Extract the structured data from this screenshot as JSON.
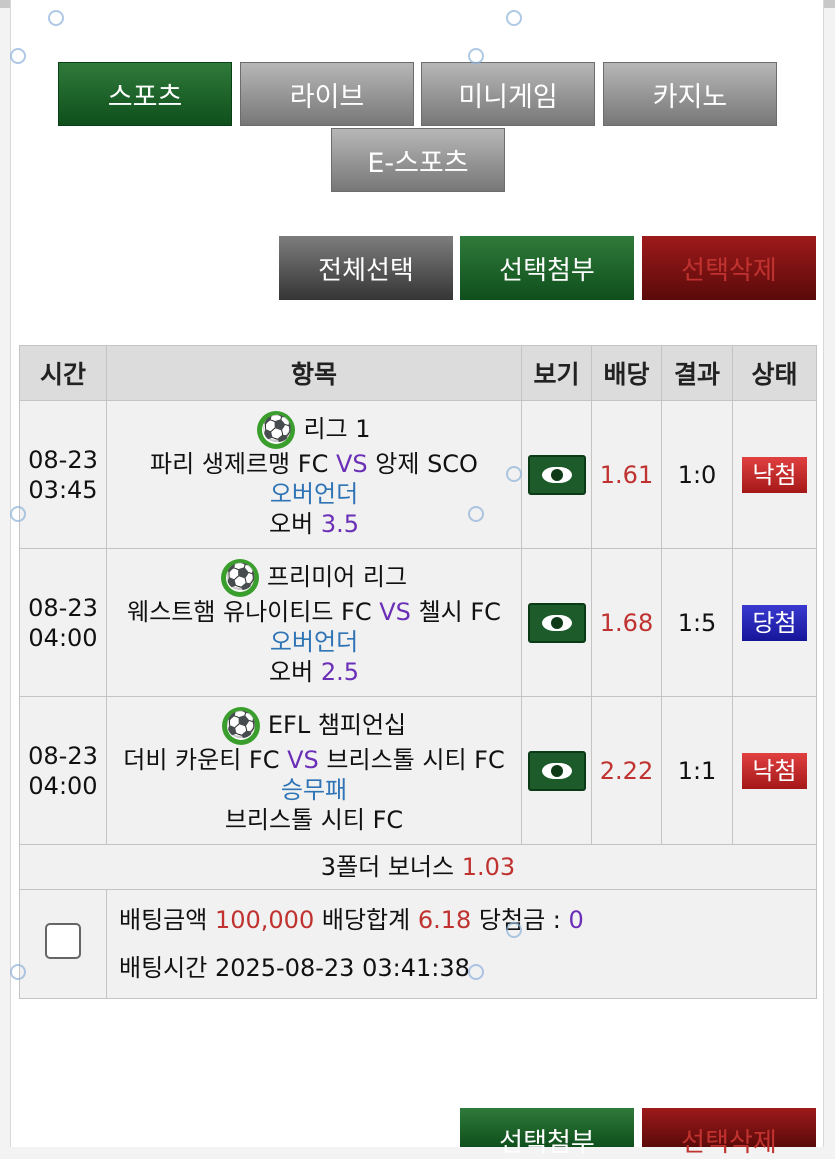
{
  "tabs": [
    {
      "label": "스포츠",
      "active": true
    },
    {
      "label": "라이브",
      "active": false
    },
    {
      "label": "미니게임",
      "active": false
    },
    {
      "label": "카지노",
      "active": false
    },
    {
      "label": "E-스포츠",
      "active": false
    }
  ],
  "actions": {
    "select_all": "전체선택",
    "attach": "선택첨부",
    "delete": "선택삭제"
  },
  "table": {
    "headers": [
      "시간",
      "항목",
      "보기",
      "배당",
      "결과",
      "상태"
    ],
    "rows": [
      {
        "date": "08-23",
        "time": "03:45",
        "league": "리그 1",
        "home": "파리 생제르맹 FC",
        "vs": "VS",
        "away": "앙제 SCO",
        "market": "오버언더",
        "pick": "오버",
        "line": "3.5",
        "odds": "1.61",
        "result": "1:0",
        "status": "낙첨"
      },
      {
        "date": "08-23",
        "time": "04:00",
        "league": "프리미어 리그",
        "home": "웨스트햄 유나이티드 FC",
        "vs": "VS",
        "away": "첼시 FC",
        "market": "오버언더",
        "pick": "오버",
        "line": "2.5",
        "odds": "1.68",
        "result": "1:5",
        "status": "당첨"
      },
      {
        "date": "08-23",
        "time": "04:00",
        "league": "EFL 챔피언십",
        "home": "더비 카운티 FC",
        "vs": "VS",
        "away": "브리스톨 시티 FC",
        "market": "승무패",
        "pick": "브리스톨 시티 FC",
        "line": "",
        "odds": "2.22",
        "result": "1:1",
        "status": "낙첨"
      }
    ],
    "bonus": {
      "label": "3폴더 보너스",
      "value": "1.03"
    },
    "summary": {
      "amount_label": "배팅금액",
      "amount": "100,000",
      "total_odds_label": "배당합계",
      "total_odds": "6.18",
      "winnings_label": "당첨금 :",
      "winnings": "0",
      "time_label": "배팅시간",
      "time": "2025-08-23 03:41:38"
    }
  },
  "bottom_actions": {
    "attach": "선택첨부",
    "delete": "선택삭제"
  },
  "colors": {
    "green": "#1e5b2b",
    "red": "#a51818",
    "blue": "#16169a",
    "odds": "#c0322f",
    "vs": "#6a2fb6",
    "pick": "#2f74b5"
  }
}
